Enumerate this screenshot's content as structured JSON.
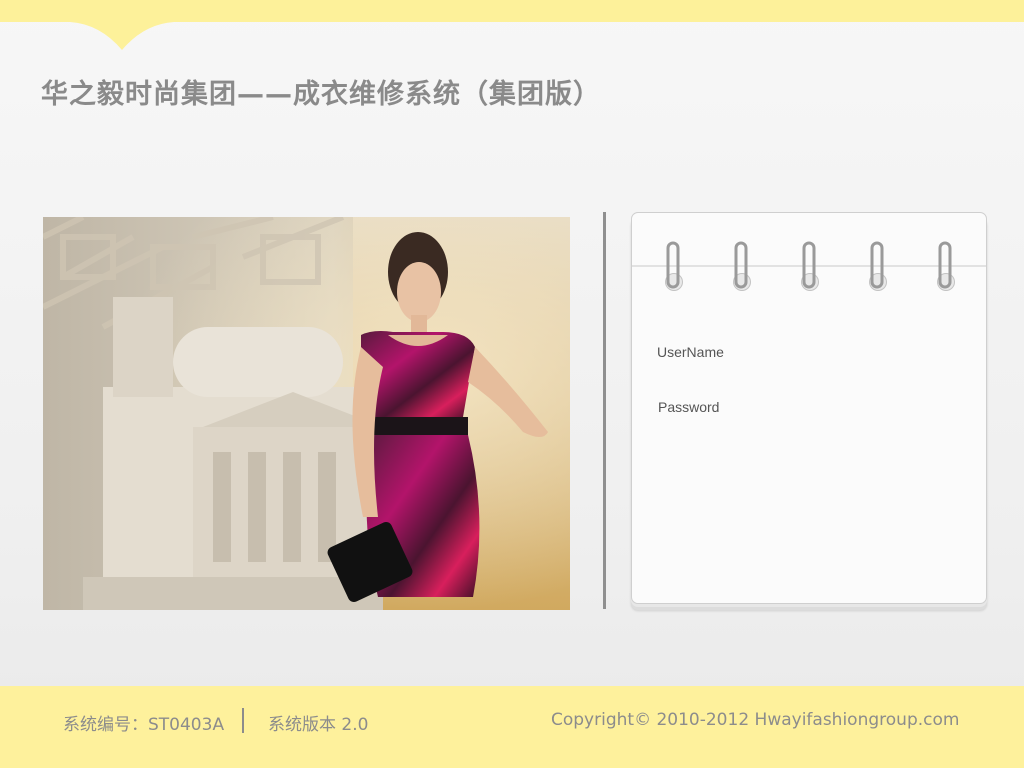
{
  "header": {
    "title": "华之毅时尚集团——成衣维修系统（集团版）"
  },
  "login": {
    "username_label": "UserName",
    "password_label": "Password",
    "ring_count": 5
  },
  "footer": {
    "system_code": "系统编号：ST0403A",
    "system_version": "系统版本  2.0",
    "copyright": "Copyright©  2010-2012 Hwayifashiongroup.com"
  },
  "colors": {
    "accent_yellow": "#fdf19a",
    "title_gray": "#8a8a8a",
    "dress_magenta": "#a0105a"
  },
  "images": {
    "hero": "fashion-model-photo"
  }
}
